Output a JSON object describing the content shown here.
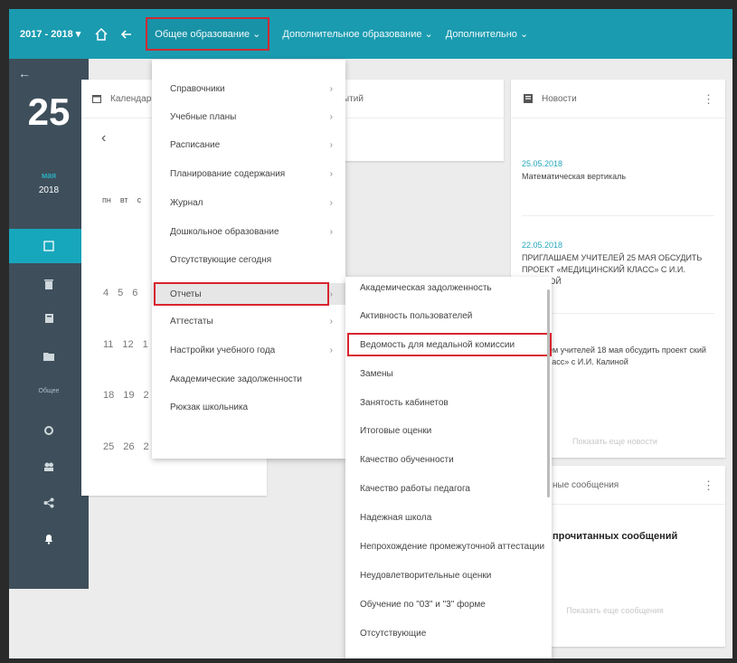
{
  "topbar": {
    "year": "2017 - 2018 ▾",
    "menus": [
      "Общее образование ⌄",
      "Дополнительное образование ⌄",
      "Дополнительно ⌄"
    ]
  },
  "rail": {
    "day": "25",
    "month": "мая",
    "year": "2018",
    "label": "Общее"
  },
  "calendar": {
    "title": "Календарь",
    "prev": "‹",
    "weekdays": [
      "пн",
      "вт",
      "с"
    ],
    "rows": [
      [
        "4",
        "5",
        "6"
      ],
      [
        "11",
        "12",
        "1"
      ],
      [
        "18",
        "19",
        "2"
      ],
      [
        "25",
        "26",
        "2"
      ]
    ]
  },
  "events": {
    "title": "ытий"
  },
  "news": {
    "title": "Новости",
    "items": [
      {
        "date": "25.05.2018",
        "title": "Математическая вертикаль"
      },
      {
        "date": "22.05.2018",
        "title": "ПРИГЛАШАЕМ УЧИТЕЛЕЙ 25 МАЯ ОБСУДИТЬ ПРОЕКТ «МЕДИЦИНСКИЙ КЛАСС» С И.И. КАЛИНОЙ"
      },
      {
        "date": "8",
        "title": "аем учителей 18 мая обсудить проект ский класс» с И.И. Калиной"
      }
    ],
    "more": "Показать еще новости"
  },
  "messages": {
    "title": "ные сообщения",
    "empty": "прочитанных сообщений",
    "more": "Показать еще сообщения"
  },
  "menu1": {
    "items": [
      {
        "label": "Справочники",
        "chev": "›"
      },
      {
        "label": "Учебные планы",
        "chev": "›"
      },
      {
        "label": "Расписание",
        "chev": "›"
      },
      {
        "label": "Планирование содержания",
        "chev": "›"
      },
      {
        "label": "Журнал",
        "chev": "›"
      },
      {
        "label": "Дошкольное образование",
        "chev": "›"
      },
      {
        "label": "Отсутствующие сегодня",
        "chev": ""
      },
      {
        "label": "Отчеты",
        "chev": "›"
      },
      {
        "label": "Аттестаты",
        "chev": "›"
      },
      {
        "label": "Настройки учебного года",
        "chev": "›"
      },
      {
        "label": "Академические задолженности",
        "chev": ""
      },
      {
        "label": "Рюкзак школьника",
        "chev": ""
      }
    ]
  },
  "menu2": {
    "items": [
      "Академическая задолженность",
      "Активность пользователей",
      "Ведомость для медальной комиссии",
      "Замены",
      "Занятость кабинетов",
      "Итоговые оценки",
      "Качество обученности",
      "Качество работы педагога",
      "Надежная школа",
      "Непрохождение промежуточной аттестации",
      "Неудовлетворительные оценки",
      "Обучение по \"03\" и \"3\" форме",
      "Отсутствующие"
    ]
  },
  "colors": {
    "topbar": "#1a9bb0",
    "rail": "#3e4f5b",
    "highlight": "#d8252f"
  }
}
